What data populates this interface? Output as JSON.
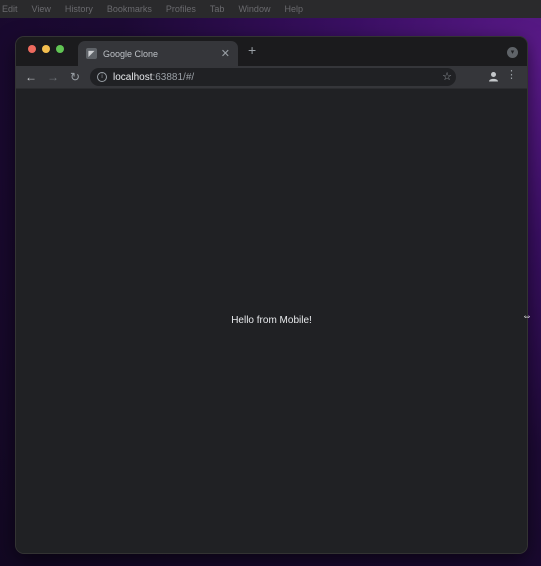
{
  "menubar": {
    "items": [
      "Edit",
      "View",
      "History",
      "Bookmarks",
      "Profiles",
      "Tab",
      "Window",
      "Help"
    ]
  },
  "browser": {
    "tab": {
      "title": "Google Clone",
      "favicon": "app-icon"
    },
    "new_tab": "+",
    "url": {
      "host": "localhost",
      "rest": ":63881/#/"
    }
  },
  "page": {
    "text": "Hello from Mobile!"
  },
  "colors": {
    "window_bg": "#202124",
    "toolbar_bg": "#35363a",
    "text": "#e8eaed"
  }
}
